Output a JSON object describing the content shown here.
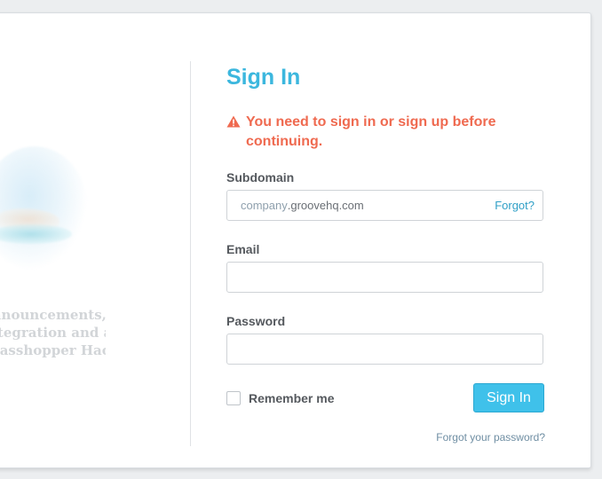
{
  "promo": {
    "lines": [
      "Announcements,",
      "Integration and an",
      "Grasshopper Hack"
    ]
  },
  "form": {
    "title": "Sign In",
    "alert": {
      "icon": "warning-icon",
      "text": "You need to sign in or sign up before continuing.",
      "color": "#ef6a50"
    },
    "subdomain": {
      "label": "Subdomain",
      "placeholder": "company",
      "suffix": ".groovehq.com",
      "forgot_label": "Forgot?"
    },
    "email": {
      "label": "Email",
      "value": ""
    },
    "password": {
      "label": "Password",
      "value": ""
    },
    "remember": {
      "label": "Remember me",
      "checked": false
    },
    "submit_label": "Sign In",
    "forgot_password_label": "Forgot your password?"
  },
  "colors": {
    "accent": "#3cb7de",
    "button": "#3fc1ea",
    "link": "#2f9fc6"
  }
}
